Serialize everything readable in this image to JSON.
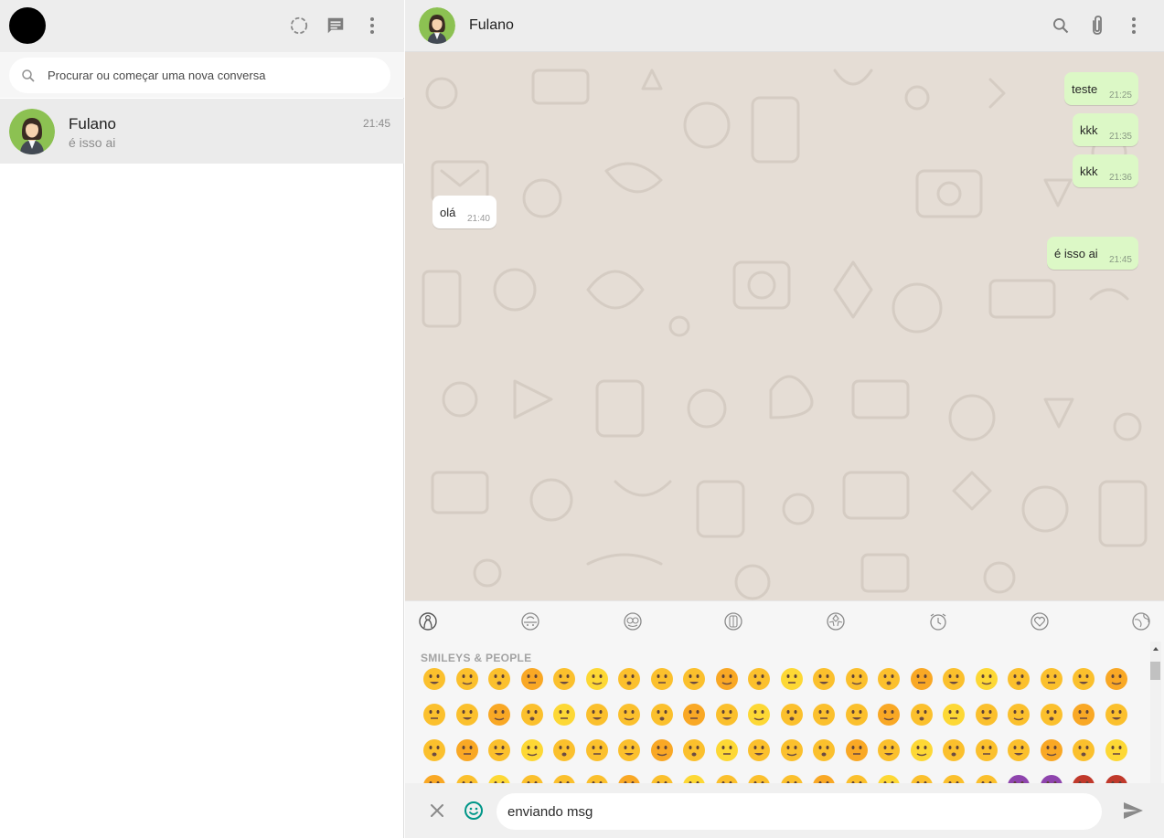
{
  "app": {
    "theme_accent": "#009688",
    "bubble_out_color": "#dcf8c6",
    "chat_bg_color": "#e5ddd5"
  },
  "left": {
    "header_icons": [
      "status-icon",
      "new-chat-icon",
      "menu-icon"
    ],
    "search": {
      "placeholder": "Procurar ou começar uma nova conversa",
      "value": ""
    },
    "chats": [
      {
        "name": "Fulano",
        "time": "21:45",
        "last_message": "é isso ai"
      }
    ]
  },
  "conversation": {
    "contact_name": "Fulano",
    "header_icons": [
      "search-icon",
      "attach-icon",
      "menu-icon"
    ],
    "messages": [
      {
        "text": "teste",
        "time": "21:25",
        "direction": "out"
      },
      {
        "text": "kkk",
        "time": "21:35",
        "direction": "out"
      },
      {
        "text": "kkk",
        "time": "21:36",
        "direction": "out"
      },
      {
        "text": "olá",
        "time": "21:40",
        "direction": "in"
      },
      {
        "text": "é isso ai",
        "time": "21:45",
        "direction": "out"
      }
    ]
  },
  "emoji_panel": {
    "categories": [
      "smileys-people",
      "animals-nature",
      "food-drink",
      "activity",
      "travel-places",
      "objects",
      "symbols",
      "flags"
    ],
    "active_category": "smileys-people",
    "section_title": "SMILEYS & PEOPLE"
  },
  "composer": {
    "input_value": "enviando msg",
    "input_placeholder": ""
  }
}
